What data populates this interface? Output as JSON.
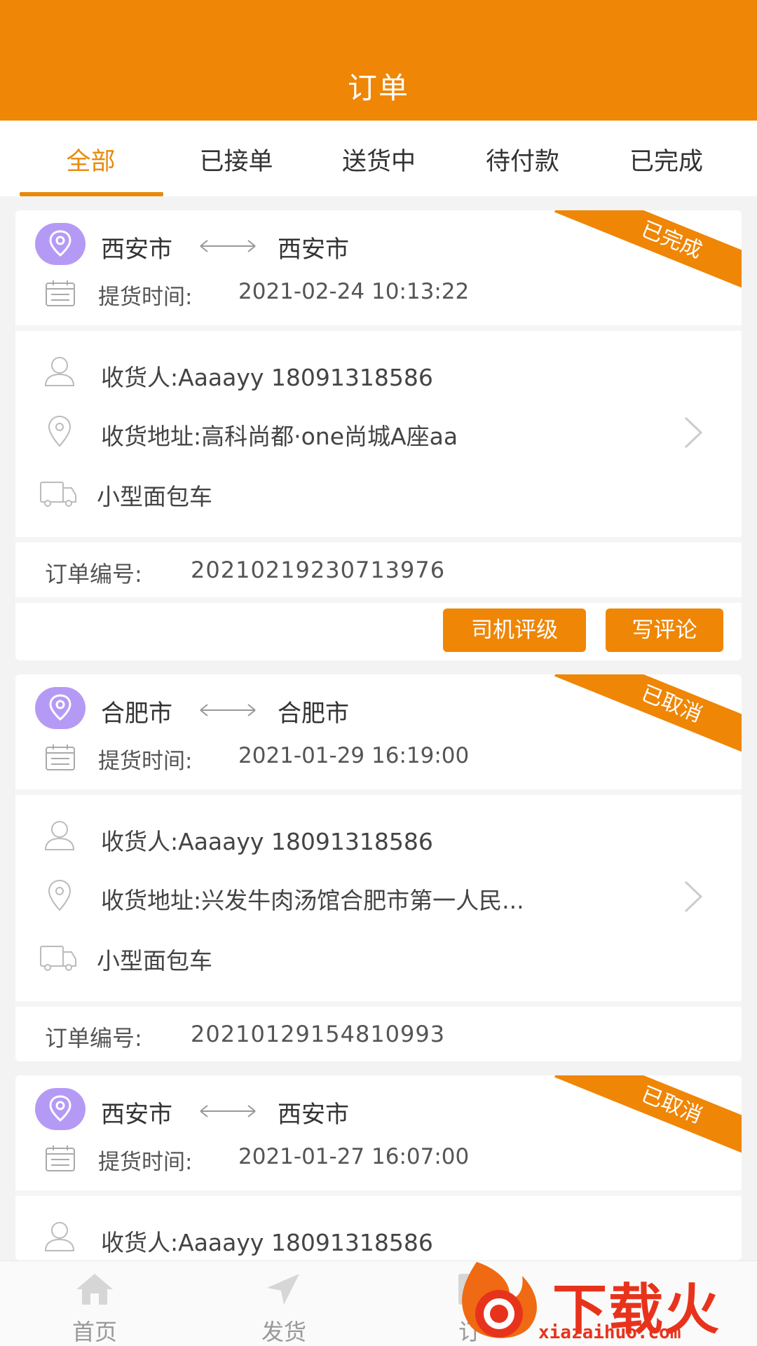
{
  "header": {
    "title": "订单"
  },
  "tabs": [
    {
      "label": "全部",
      "active": true
    },
    {
      "label": "已接单",
      "active": false
    },
    {
      "label": "送货中",
      "active": false
    },
    {
      "label": "待付款",
      "active": false
    },
    {
      "label": "已完成",
      "active": false
    }
  ],
  "labels": {
    "pickup_time": "提货时间:",
    "consignee": "收货人:",
    "address": "收货地址:",
    "order_no": "订单编号:"
  },
  "orders": [
    {
      "status": "已完成",
      "from_city": "西安市",
      "to_city": "西安市",
      "pickup_time": "2021-02-24 10:13:22",
      "consignee": "Aaaayy 18091318586",
      "address": "高科尚都·one尚城A座aa",
      "vehicle": "小型面包车",
      "order_no": "20210219230713976",
      "buttons": {
        "rate_driver": "司机评级",
        "write_review": "写评论"
      }
    },
    {
      "status": "已取消",
      "from_city": "合肥市",
      "to_city": "合肥市",
      "pickup_time": "2021-01-29 16:19:00",
      "consignee": "Aaaayy 18091318586",
      "address": "兴发牛肉汤馆合肥市第一人民...",
      "vehicle": "小型面包车",
      "order_no": "20210129154810993"
    },
    {
      "status": "已取消",
      "from_city": "西安市",
      "to_city": "西安市",
      "pickup_time": "2021-01-27 16:07:00",
      "consignee": "Aaaayy 18091318586"
    }
  ],
  "bottom_nav": [
    {
      "label": "首页",
      "icon": "home-icon"
    },
    {
      "label": "发货",
      "icon": "send-icon"
    },
    {
      "label": "订",
      "icon": "order-icon"
    }
  ],
  "watermark": {
    "text": "下载火",
    "sub": "xiazaihuo.com"
  },
  "colors": {
    "accent": "#ef8605",
    "tab_active": "#e78a0a",
    "route_icon": "#b59af5"
  }
}
